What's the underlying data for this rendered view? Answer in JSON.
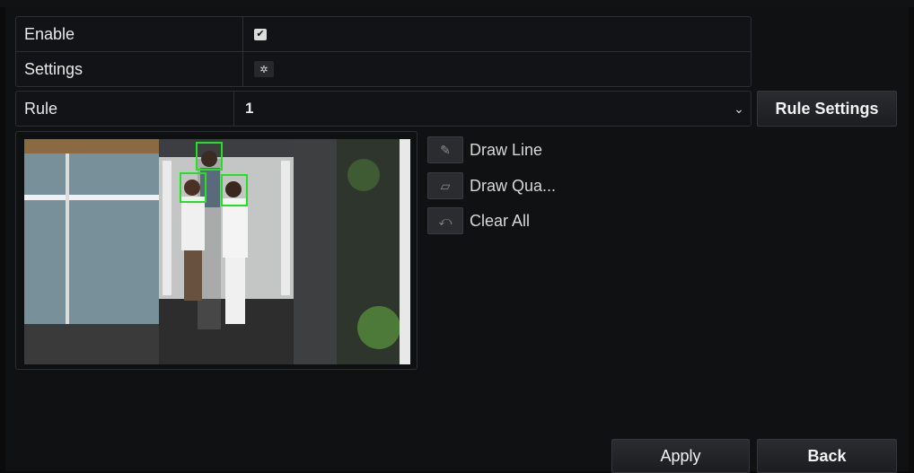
{
  "form": {
    "enable_label": "Enable",
    "enable_checked": true,
    "settings_label": "Settings",
    "rule_label": "Rule",
    "rule_value": "1",
    "rule_settings_button": "Rule Settings"
  },
  "tools": [
    {
      "label": "Draw Line",
      "icon": "pencil-icon"
    },
    {
      "label": "Draw Qua...",
      "icon": "edit-quad-icon"
    },
    {
      "label": "Clear All",
      "icon": "clear-icon"
    }
  ],
  "footer": {
    "apply_label": "Apply",
    "back_label": "Back"
  },
  "icons": {
    "checkbox_glyph": "✔",
    "settings_glyph": "✲",
    "dropdown_glyph": "⌄"
  },
  "video": {
    "detection_color": "#22e222"
  }
}
